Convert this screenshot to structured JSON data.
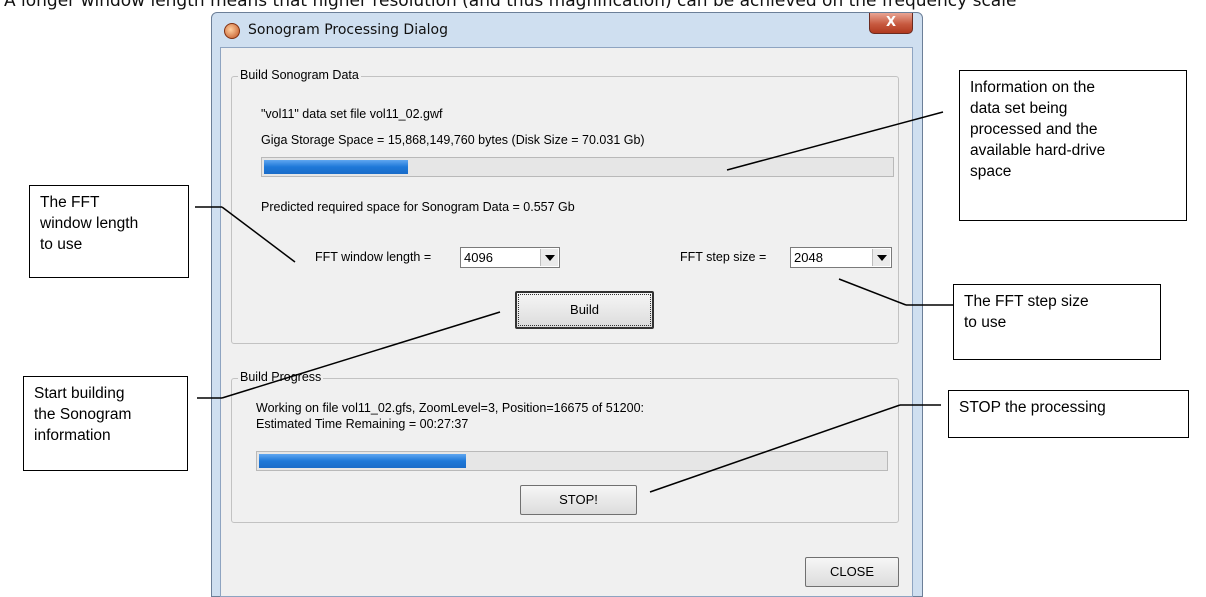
{
  "caption": "A longer window length means that higher resolution (and thus magnification) can be achieved on the frequency scale",
  "window": {
    "title": "Sonogram Processing Dialog",
    "close_glyph": "X"
  },
  "build_group": {
    "title": "Build Sonogram Data",
    "dataset_line": "\"vol11\" data set file vol11_02.gwf",
    "storage_line": "Giga Storage Space = 15,868,149,760 bytes (Disk Size = 70.031 Gb)",
    "storage_progress": 0.23,
    "predicted_line": "Predicted required space for Sonogram Data =  0.557 Gb",
    "fft_window_label": "FFT window length =",
    "fft_window_value": "4096",
    "fft_step_label": "FFT step size =",
    "fft_step_value": "2048",
    "build_button": "Build"
  },
  "progress_group": {
    "title": "Build Progress",
    "status_line1": "Working on file vol11_02.gfs, ZoomLevel=3, Position=16675 of 51200:",
    "status_line2": "Estimated Time Remaining = 00:27:37",
    "progress": 0.33,
    "stop_button": "STOP!"
  },
  "close_button": "CLOSE",
  "callouts": {
    "info": "Information on the\ndata set being\nprocessed and the\navailable hard-drive\nspace",
    "fft_window": "The FFT\nwindow length\nto use",
    "fft_step": "The FFT step size\nto use",
    "start": "Start building\nthe Sonogram\ninformation",
    "stop": "STOP the processing"
  }
}
